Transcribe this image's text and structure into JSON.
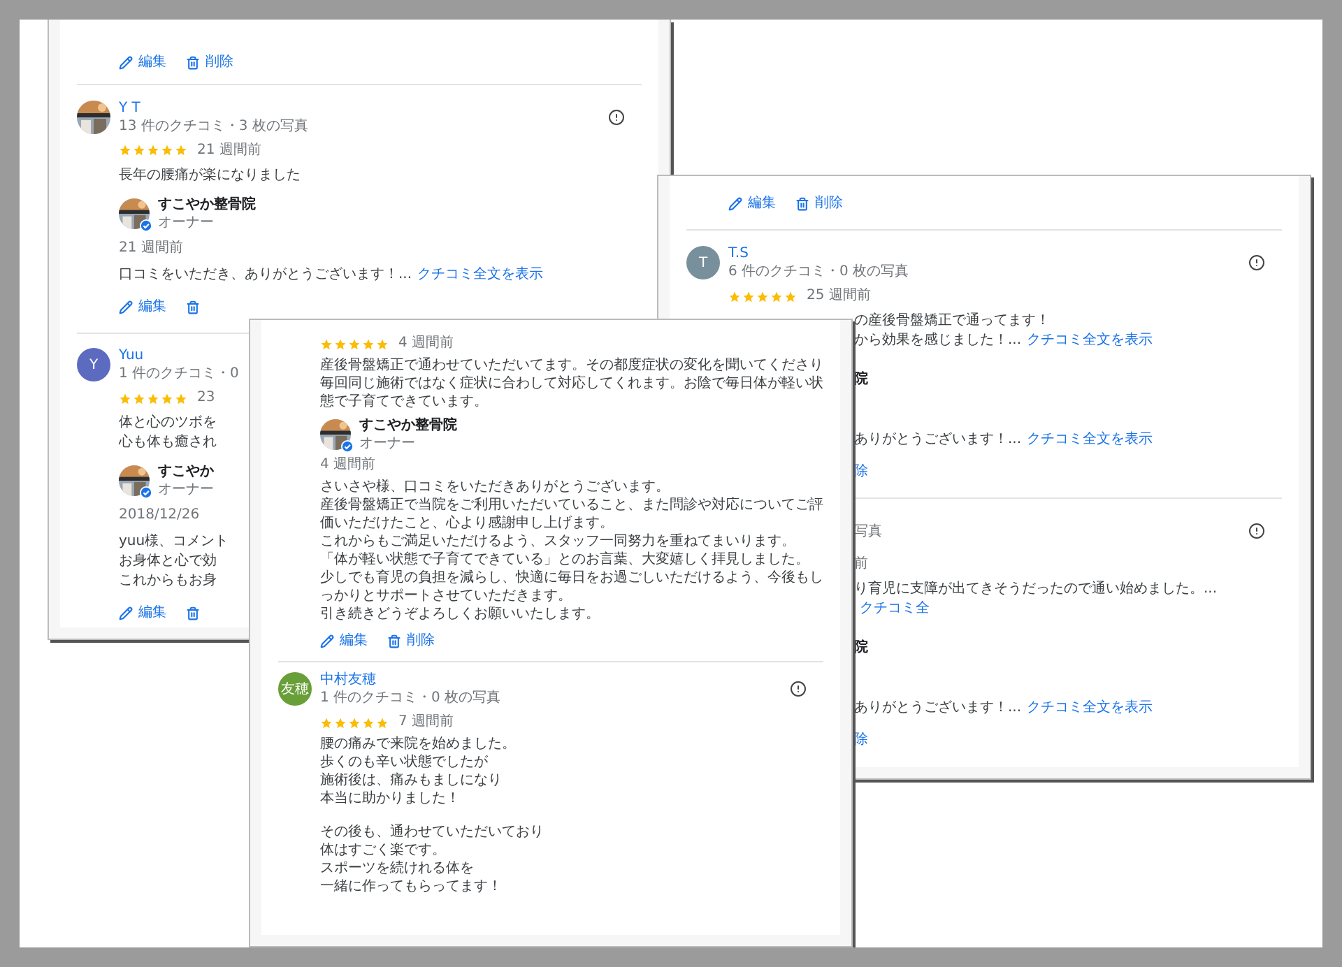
{
  "left": {
    "top_actions": [
      {
        "kind": "edit",
        "label": "編集",
        "icon": true
      },
      {
        "kind": "delete",
        "label": "削除",
        "icon": true
      }
    ],
    "reviews": [
      {
        "name": "Y T",
        "meta": "13 件のクチコミ・3 枚の写真",
        "avatar": {
          "kind": "picture"
        },
        "report": true,
        "stars": 5,
        "time": "21 週間前",
        "paragraphs": [
          [
            "長年の腰痛が楽になりました"
          ]
        ],
        "reply": {
          "owner": "すこやか整骨院",
          "role": "オーナー",
          "time": "21 週間前",
          "lines": [
            "口コミをいただき、ありがとうございます！..."
          ],
          "link": "クチコミ全文を表示"
        },
        "actions": [
          {
            "kind": "edit",
            "label": "編集",
            "icon": true
          },
          {
            "kind": "delete",
            "icon": true
          }
        ]
      },
      {
        "name": "Yuu",
        "meta": "1 件のクチコミ・0",
        "avatar": {
          "kind": "letter",
          "letter": "Y",
          "color": "#5c6bc0"
        },
        "report": false,
        "stars": 5,
        "time": "23",
        "paragraphs": [
          [
            "体と心のツボを",
            "心も体も癒され"
          ]
        ],
        "reply": {
          "owner": "すこやか",
          "role": "オーナー",
          "time": "2018/12/26",
          "lines": [
            "yuu様、コメント",
            "お身体と心で効",
            "これからもお身"
          ]
        },
        "actions": [
          {
            "kind": "edit",
            "label": "編集",
            "icon": true
          },
          {
            "kind": "delete",
            "icon": true
          }
        ]
      }
    ]
  },
  "right": {
    "top_actions": [
      {
        "kind": "edit",
        "label": "編集",
        "icon": true
      },
      {
        "kind": "delete",
        "label": "削除",
        "icon": true
      }
    ],
    "reviews": [
      {
        "name": "T.S",
        "meta": "6 件のクチコミ・0 枚の写真",
        "avatar": {
          "kind": "letter",
          "letter": "T",
          "color": "#78909c"
        },
        "report": true,
        "stars": 5,
        "time": "25 週間前",
        "paragraphs": [
          [
            "の産後骨盤矯正で通ってます！",
            "から効果を感じました！..."
          ]
        ],
        "link": "クチコミ全文を表示",
        "reply": {
          "owner": "院",
          "lines": [
            "ありがとうございます！..."
          ],
          "link": "クチコミ全文を表示"
        },
        "actions": [
          {
            "label": "除",
            "icon": false
          }
        ]
      },
      {
        "meta": "写真",
        "report": true,
        "time": "前",
        "paragraphs": [
          [
            "り育児に支障が出てきそうだったので通い始めました。..."
          ]
        ],
        "link": "クチコミ全",
        "reply": {
          "owner": "院",
          "lines": [
            "ありがとうございます！..."
          ],
          "link": "クチコミ全文を表示"
        },
        "actions": [
          {
            "label": "除",
            "icon": false
          }
        ]
      }
    ]
  },
  "front": {
    "reviews": [
      {
        "stars": 5,
        "time": "4 週間前",
        "paragraphs": [
          [
            "産後骨盤矯正で通わせていただいてます。その都度症状の変化を聞いてくださり毎回同じ施術ではなく症状に合わして対応してくれます。お陰で毎日体が軽い状態で子育てできています。"
          ]
        ],
        "reply": {
          "owner": "すこやか整骨院",
          "role": "オーナー",
          "time": "4 週間前",
          "lines": [
            "さいさや様、口コミをいただきありがとうございます。",
            "産後骨盤矯正で当院をご利用いただいていること、また問診や対応についてご評価いただけたこと、心より感謝申し上げます。",
            "これからもご満足いただけるよう、スタッフ一同努力を重ねてまいります。",
            "「体が軽い状態で子育てできている」とのお言葉、大変嬉しく拝見しました。",
            "少しでも育児の負担を減らし、快適に毎日をお過ごしいただけるよう、今後もしっかりとサポートさせていただきます。",
            "引き続きどうぞよろしくお願いいたします。"
          ]
        },
        "actions": [
          {
            "kind": "edit",
            "label": "編集",
            "icon": true
          },
          {
            "kind": "delete",
            "label": "削除",
            "icon": true
          }
        ]
      },
      {
        "name": "中村友穂",
        "meta": "1 件のクチコミ・0 枚の写真",
        "avatar": {
          "kind": "letter",
          "letter": "友穂",
          "color": "#689f38"
        },
        "report": true,
        "stars": 5,
        "time": "7 週間前",
        "paragraphs": [
          [
            "腰の痛みで来院を始めました。",
            "歩くのも辛い状態でしたが",
            "施術後は、痛みもましになり",
            "本当に助かりました！"
          ],
          [
            "その後も、通わせていただいており",
            "体はすごく楽です。",
            "スポーツを続けれる体を",
            "一緒に作ってもらってます！"
          ]
        ]
      }
    ]
  }
}
